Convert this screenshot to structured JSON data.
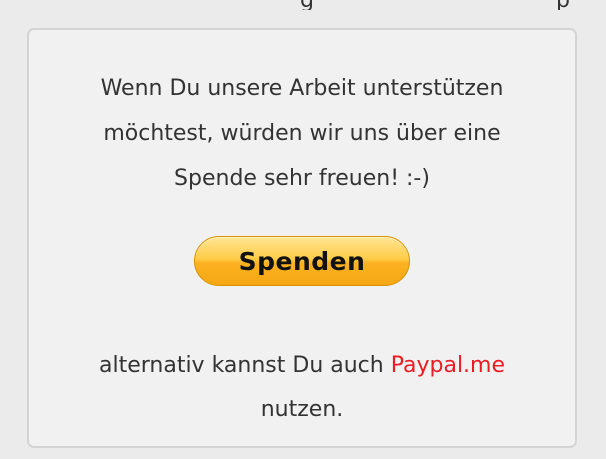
{
  "donation_panel": {
    "intro_text": "Wenn Du unsere Arbeit unterstützen\nmöchtest, würden wir uns über eine\nSpende sehr freuen! :-)",
    "donate_button_label": "Spenden",
    "alternative_prefix": "alternativ kannst Du auch ",
    "paypal_link_label": "Paypal.me",
    "alternative_suffix": "nutzen."
  },
  "colors": {
    "page_background": "#ebebeb",
    "panel_background": "#f1f1f1",
    "panel_border": "#d4d4d4",
    "text": "#333333",
    "link": "#ee1b24",
    "button_top": "#ffe594",
    "button_bottom": "#f6a813"
  }
}
